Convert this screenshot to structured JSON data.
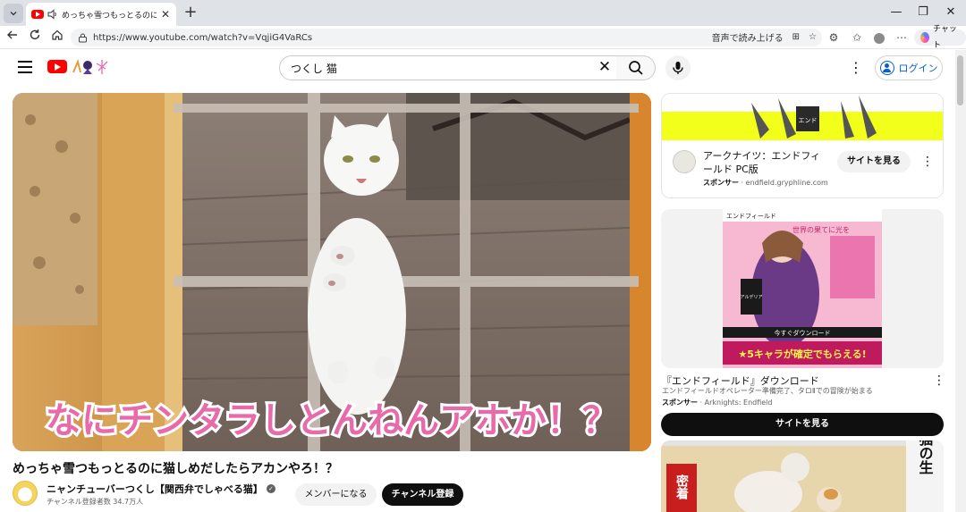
{
  "browser": {
    "tab_title": "めっちゃ雪つもっとるのに猫しめだしたらアカンやろ！？",
    "tab_close": "✕",
    "new_tab": "+",
    "url": "https://www.youtube.com/watch?v=VqjiG4VaRCs",
    "read_aloud": "音声で読み上げる",
    "chat_label": "チャット",
    "window_controls": [
      "—",
      "❐",
      "✕"
    ]
  },
  "youtube": {
    "search_query": "つくし 猫",
    "signin_label": "ログイン",
    "video": {
      "overlay_caption": "なにチンタラしとんねんアホか！？",
      "title": "めっちゃ雪つもっとるのに猫しめだしたらアカンやろ！？",
      "channel_name": "ニャンチューバーつくし【関西弁でしゃべる猫】",
      "subscribers": "チャンネル登録者数 34.7万人",
      "member_button": "メンバーになる",
      "subscribe_button": "チャンネル登録"
    },
    "ad1": {
      "banner_label": "エンド",
      "title": "アークナイツ：エンドフィールド PC版",
      "sponsor_label": "スポンサー",
      "sponsor_domain": "endfield.gryphline.com",
      "cta": "サイトを見る"
    },
    "ad2": {
      "art_header": "エンドフィールド",
      "art_lines": [
        "世界の果てに光を",
        "今すぐダウンロード"
      ],
      "art_badge": "★5キャラが確定でもらえる!",
      "art_name": "アルデリア",
      "title": "『エンドフィールド』ダウンロード",
      "description": "エンドフィールドオペレーター準備完了、タロⅡでの冒険が始まる",
      "sponsor_label": "スポンサー",
      "sponsor_name": "Arknights: Endfield",
      "cta": "サイトを見る"
    },
    "rec": {
      "thumb_text_left": "密着",
      "thumb_text_right": "猫の生"
    }
  }
}
